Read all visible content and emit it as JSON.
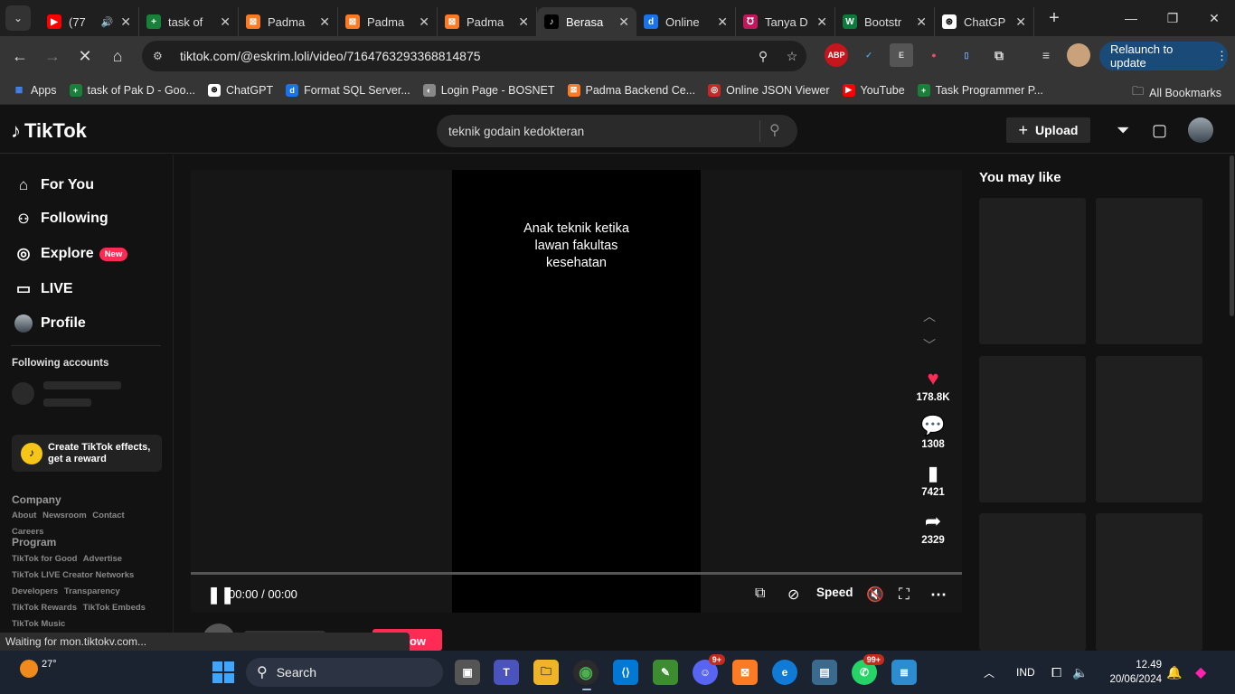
{
  "browser": {
    "tabs": [
      {
        "title": "(77",
        "fav_color": "#ff0000",
        "fav_glyph": "▶",
        "extra": "🔊"
      },
      {
        "title": "task of",
        "fav_color": "#188038",
        "fav_glyph": "+"
      },
      {
        "title": "Padma",
        "fav_color": "#fb7a24",
        "fav_glyph": "⊠"
      },
      {
        "title": "Padma",
        "fav_color": "#fb7a24",
        "fav_glyph": "⊠"
      },
      {
        "title": "Padma",
        "fav_color": "#fb7a24",
        "fav_glyph": "⊠"
      },
      {
        "title": "Berasa",
        "fav_color": "#000000",
        "fav_glyph": "♪",
        "active": true
      },
      {
        "title": "Online",
        "fav_color": "#1a73e8",
        "fav_glyph": "d"
      },
      {
        "title": "Tanya D",
        "fav_color": "#c2185b",
        "fav_glyph": "℧"
      },
      {
        "title": "Bootstr",
        "fav_color": "#0b7a3b",
        "fav_glyph": "W"
      },
      {
        "title": "ChatGP",
        "fav_color": "#ffffff",
        "fav_glyph": "⊛"
      }
    ],
    "url": "tiktok.com/@eskrim.loli/video/7164763293368814875",
    "relaunch_label": "Relaunch to update",
    "extensions": [
      "ABP",
      "✓",
      "E",
      "●",
      "▯",
      "⧉"
    ],
    "bookmarks": [
      {
        "label": "Apps",
        "color": "#4285f4",
        "glyph": "▦"
      },
      {
        "label": "task of Pak D - Goo...",
        "color": "#188038",
        "glyph": "+"
      },
      {
        "label": "ChatGPT",
        "color": "#ffffff",
        "glyph": "⊛"
      },
      {
        "label": "Format SQL Server...",
        "color": "#1a73e8",
        "glyph": "d"
      },
      {
        "label": "Login Page - BOSNET",
        "color": "#888888",
        "glyph": "◐"
      },
      {
        "label": "Padma Backend Ce...",
        "color": "#fb7a24",
        "glyph": "⊠"
      },
      {
        "label": "Online JSON Viewer",
        "color": "#c62828",
        "glyph": "◎"
      },
      {
        "label": "YouTube",
        "color": "#ff0000",
        "glyph": "▶"
      },
      {
        "label": "Task Programmer P...",
        "color": "#188038",
        "glyph": "+"
      }
    ],
    "all_bookmarks": "All Bookmarks",
    "status_text": "Waiting for mon.tiktokv.com..."
  },
  "tiktok": {
    "logo": "TikTok",
    "search_value": "teknik godain kedokteran",
    "upload_label": "Upload",
    "nav": [
      {
        "label": "For You",
        "icon": "⌂"
      },
      {
        "label": "Following",
        "icon": "👥"
      },
      {
        "label": "Explore",
        "icon": "◎",
        "badge": "New"
      },
      {
        "label": "LIVE",
        "icon": "▭"
      },
      {
        "label": "Profile",
        "icon": "avatar"
      }
    ],
    "following_accounts": "Following accounts",
    "effects_line1": "Create TikTok effects,",
    "effects_line2": "get a reward",
    "company_title": "Company",
    "company_links": [
      "About",
      "Newsroom",
      "Contact",
      "Careers"
    ],
    "program_title": "Program",
    "program_links": [
      "TikTok for Good",
      "Advertise",
      "TikTok LIVE Creator Networks",
      "Developers",
      "Transparency",
      "TikTok Rewards",
      "TikTok Embeds",
      "TikTok Music"
    ],
    "video": {
      "caption_line1": "Anak teknik ketika",
      "caption_line2": "lawan fakultas",
      "caption_line3": "kesehatan",
      "time": "00:00 / 00:00",
      "speed_label": "Speed",
      "likes": "178.8K",
      "comments": "1308",
      "saves": "7421",
      "shares": "2329"
    },
    "follow_label": "ow",
    "you_may_like": "You may like"
  },
  "taskbar": {
    "temperature": "27°",
    "search_label": "Search",
    "discord_badge": "9+",
    "whatsapp_badge": "99+",
    "language": "IND",
    "time": "12.49",
    "date": "20/06/2024"
  }
}
